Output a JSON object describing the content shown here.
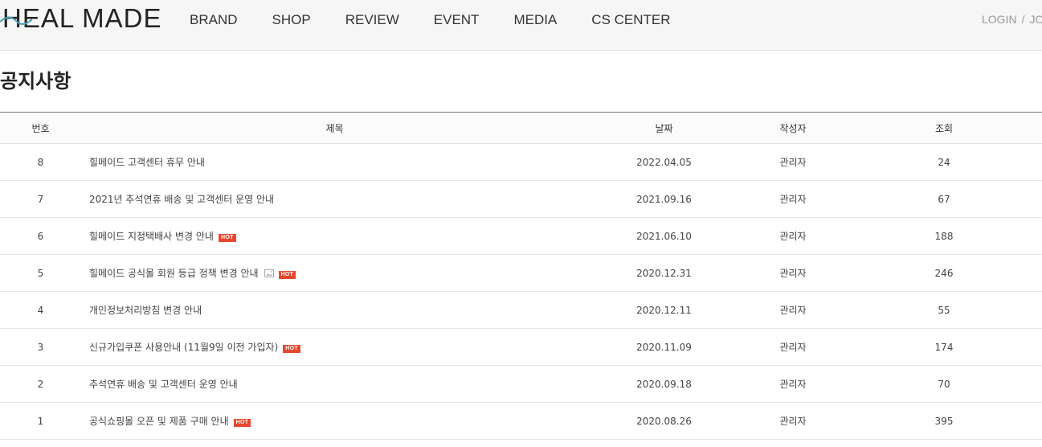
{
  "header": {
    "logo": "HEAL MADE",
    "nav": [
      "BRAND",
      "SHOP",
      "REVIEW",
      "EVENT",
      "MEDIA",
      "CS CENTER"
    ],
    "util": {
      "login": "LOGIN",
      "separator": "/",
      "join": "JOI"
    },
    "accent_color": "#4aa3b6"
  },
  "page_title": "공지사항",
  "board": {
    "columns": [
      "번호",
      "제목",
      "날짜",
      "작성자",
      "조회"
    ],
    "hot_badge_label": "HOT",
    "rows": [
      {
        "no": "8",
        "title": "힐메이드 고객센터 휴무 안내",
        "date": "2022.04.05",
        "writer": "관리자",
        "hits": "24",
        "hot": false,
        "image": false
      },
      {
        "no": "7",
        "title": "2021년 추석연휴 배송 및 고객센터 운영 안내",
        "date": "2021.09.16",
        "writer": "관리자",
        "hits": "67",
        "hot": false,
        "image": false
      },
      {
        "no": "6",
        "title": "힐메이드 지정택배사 변경 안내",
        "date": "2021.06.10",
        "writer": "관리자",
        "hits": "188",
        "hot": true,
        "image": false
      },
      {
        "no": "5",
        "title": "힐메이드 공식몰 회원 등급 정책 변경 안내",
        "date": "2020.12.31",
        "writer": "관리자",
        "hits": "246",
        "hot": true,
        "image": true
      },
      {
        "no": "4",
        "title": "개인정보처리방침 변경 안내",
        "date": "2020.12.11",
        "writer": "관리자",
        "hits": "55",
        "hot": false,
        "image": false
      },
      {
        "no": "3",
        "title": "신규가입쿠폰 사용안내 (11월9일 이전 가입자)",
        "date": "2020.11.09",
        "writer": "관리자",
        "hits": "174",
        "hot": true,
        "image": false
      },
      {
        "no": "2",
        "title": "추석연휴 배송 및 고객센터 운영 안내",
        "date": "2020.09.18",
        "writer": "관리자",
        "hits": "70",
        "hot": false,
        "image": false
      },
      {
        "no": "1",
        "title": "공식쇼핑몰 오픈 및 제품 구매 안내",
        "date": "2020.08.26",
        "writer": "관리자",
        "hits": "395",
        "hot": true,
        "image": false
      }
    ]
  },
  "colors": {
    "hot_badge": "#e8472d",
    "header_bg": "#f6f6f6"
  }
}
